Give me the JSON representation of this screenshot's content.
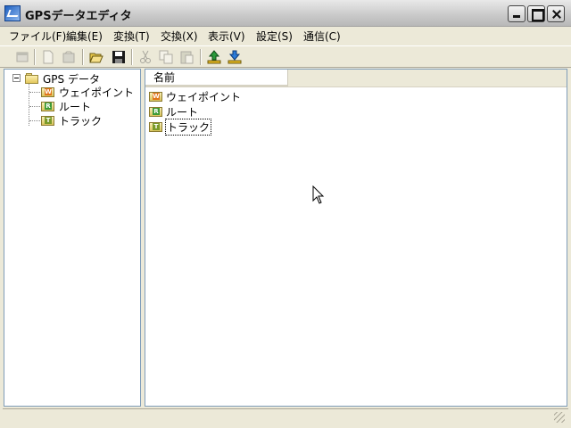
{
  "window": {
    "title": "GPSデータエディタ"
  },
  "menu": [
    "ファイル(F)",
    "編集(E)",
    "変換(T)",
    "交換(X)",
    "表示(V)",
    "設定(S)",
    "通信(C)"
  ],
  "toolbar": {
    "buttons": [
      {
        "icon": "new-window-icon",
        "enabled": false
      },
      {
        "icon": "new-document-icon",
        "enabled": false
      },
      {
        "icon": "delete-icon",
        "enabled": false
      },
      {
        "icon": "open-folder-icon",
        "enabled": true
      },
      {
        "icon": "save-disk-icon",
        "enabled": true
      },
      {
        "icon": "cut-icon",
        "enabled": false
      },
      {
        "icon": "copy-icon",
        "enabled": false
      },
      {
        "icon": "paste-icon",
        "enabled": false
      },
      {
        "icon": "upload-icon",
        "enabled": true
      },
      {
        "icon": "download-icon",
        "enabled": true
      }
    ]
  },
  "tree": {
    "root": "GPS データ",
    "children": [
      {
        "label": "ウェイポイント",
        "badge": "W"
      },
      {
        "label": "ルート",
        "badge": "R"
      },
      {
        "label": "トラック",
        "badge": "T"
      }
    ]
  },
  "list": {
    "column": "名前",
    "items": [
      {
        "label": "ウェイポイント",
        "badge": "W"
      },
      {
        "label": "ルート",
        "badge": "R"
      },
      {
        "label": "トラック",
        "badge": "T",
        "focused": true
      }
    ]
  },
  "status": {
    "text": ""
  }
}
